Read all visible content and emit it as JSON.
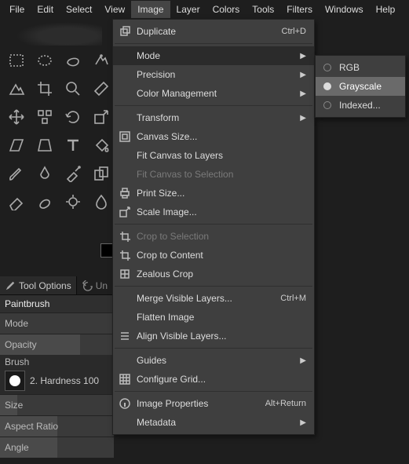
{
  "menubar": [
    "File",
    "Edit",
    "Select",
    "View",
    "Image",
    "Layer",
    "Colors",
    "Tools",
    "Filters",
    "Windows",
    "Help"
  ],
  "menubar_open_index": 4,
  "image_menu": {
    "groups": [
      [
        {
          "icon": "dup",
          "label": "Duplicate",
          "accel": "Ctrl+D"
        }
      ],
      [
        {
          "label": "Mode",
          "sub": true,
          "hl": true
        },
        {
          "label": "Precision",
          "sub": true
        },
        {
          "label": "Color Management",
          "sub": true
        }
      ],
      [
        {
          "label": "Transform",
          "sub": true
        },
        {
          "icon": "canvas",
          "label": "Canvas Size..."
        },
        {
          "label": "Fit Canvas to Layers"
        },
        {
          "label": "Fit Canvas to Selection",
          "disabled": true
        },
        {
          "icon": "print",
          "label": "Print Size..."
        },
        {
          "icon": "scale",
          "label": "Scale Image..."
        }
      ],
      [
        {
          "icon": "crop",
          "label": "Crop to Selection",
          "disabled": true
        },
        {
          "icon": "crop",
          "label": "Crop to Content"
        },
        {
          "icon": "zeal",
          "label": "Zealous Crop"
        }
      ],
      [
        {
          "label": "Merge Visible Layers...",
          "accel": "Ctrl+M"
        },
        {
          "label": "Flatten Image"
        },
        {
          "icon": "align",
          "label": "Align Visible Layers..."
        }
      ],
      [
        {
          "label": "Guides",
          "sub": true
        },
        {
          "icon": "grid",
          "label": "Configure Grid..."
        }
      ],
      [
        {
          "icon": "info",
          "label": "Image Properties",
          "accel": "Alt+Return"
        },
        {
          "label": "Metadata",
          "sub": true
        }
      ]
    ]
  },
  "mode_menu": {
    "items": [
      {
        "label": "RGB",
        "radio": true,
        "on": false
      },
      {
        "label": "Grayscale",
        "radio": true,
        "on": true,
        "sel": true
      },
      {
        "label": "Indexed...",
        "radio": true,
        "on": false
      }
    ]
  },
  "tool_options": {
    "tab_label": "Tool Options",
    "undo_tab": "Un",
    "tool_name": "Paintbrush",
    "mode_label": "Mode",
    "opacity_label": "Opacity",
    "brush_label": "Brush",
    "brush_name": "2. Hardness 100",
    "size_label": "Size",
    "aspect_label": "Aspect Ratio",
    "angle_label": "Angle"
  },
  "tool_names": [
    "rect-select",
    "ellipse-select",
    "free-select",
    "fuzzy-select",
    "color-select",
    "crop",
    "zoom",
    "measure",
    "move",
    "align",
    "rotate",
    "scale",
    "shear",
    "perspective",
    "text",
    "bucket-fill",
    "paintbrush",
    "ink",
    "airbrush",
    "clone",
    "eraser",
    "smudge",
    "dodge",
    "blur"
  ]
}
